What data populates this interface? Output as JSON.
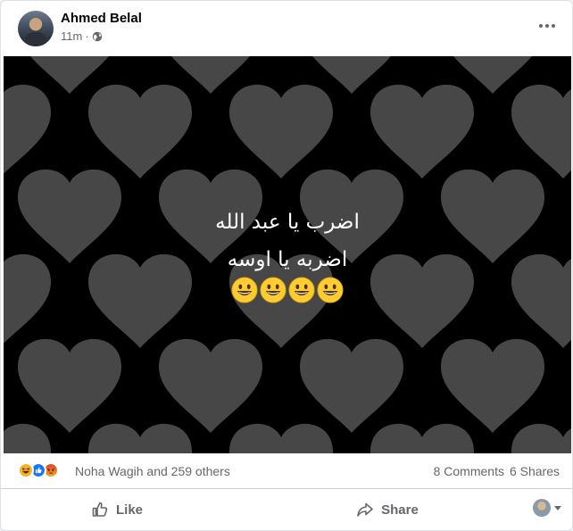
{
  "post": {
    "author": "Ahmed Belal",
    "time": "11m",
    "separator": "·",
    "privacy_icon": "globe-icon",
    "more_icon": "more-horizontal-icon"
  },
  "image": {
    "background_color": "#000000",
    "heart_color": "#474747",
    "text_line_1": "اضرب يا عبد الله",
    "text_line_2": "اضربه يا اوسه",
    "emoji": "grinning-face",
    "emoji_count": 4
  },
  "reactions": {
    "icons": [
      "haha-reaction",
      "like-reaction",
      "angry-reaction"
    ],
    "names": "Noha Wagih and 259 others",
    "comments": "8 Comments",
    "shares": "6 Shares"
  },
  "actions": {
    "like_label": "Like",
    "share_label": "Share"
  },
  "colors": {
    "secondary_text": "#65676b",
    "like_blue": "#1877f2",
    "haha_yellow": "#f7b125",
    "angry_red": "#e9710f"
  }
}
